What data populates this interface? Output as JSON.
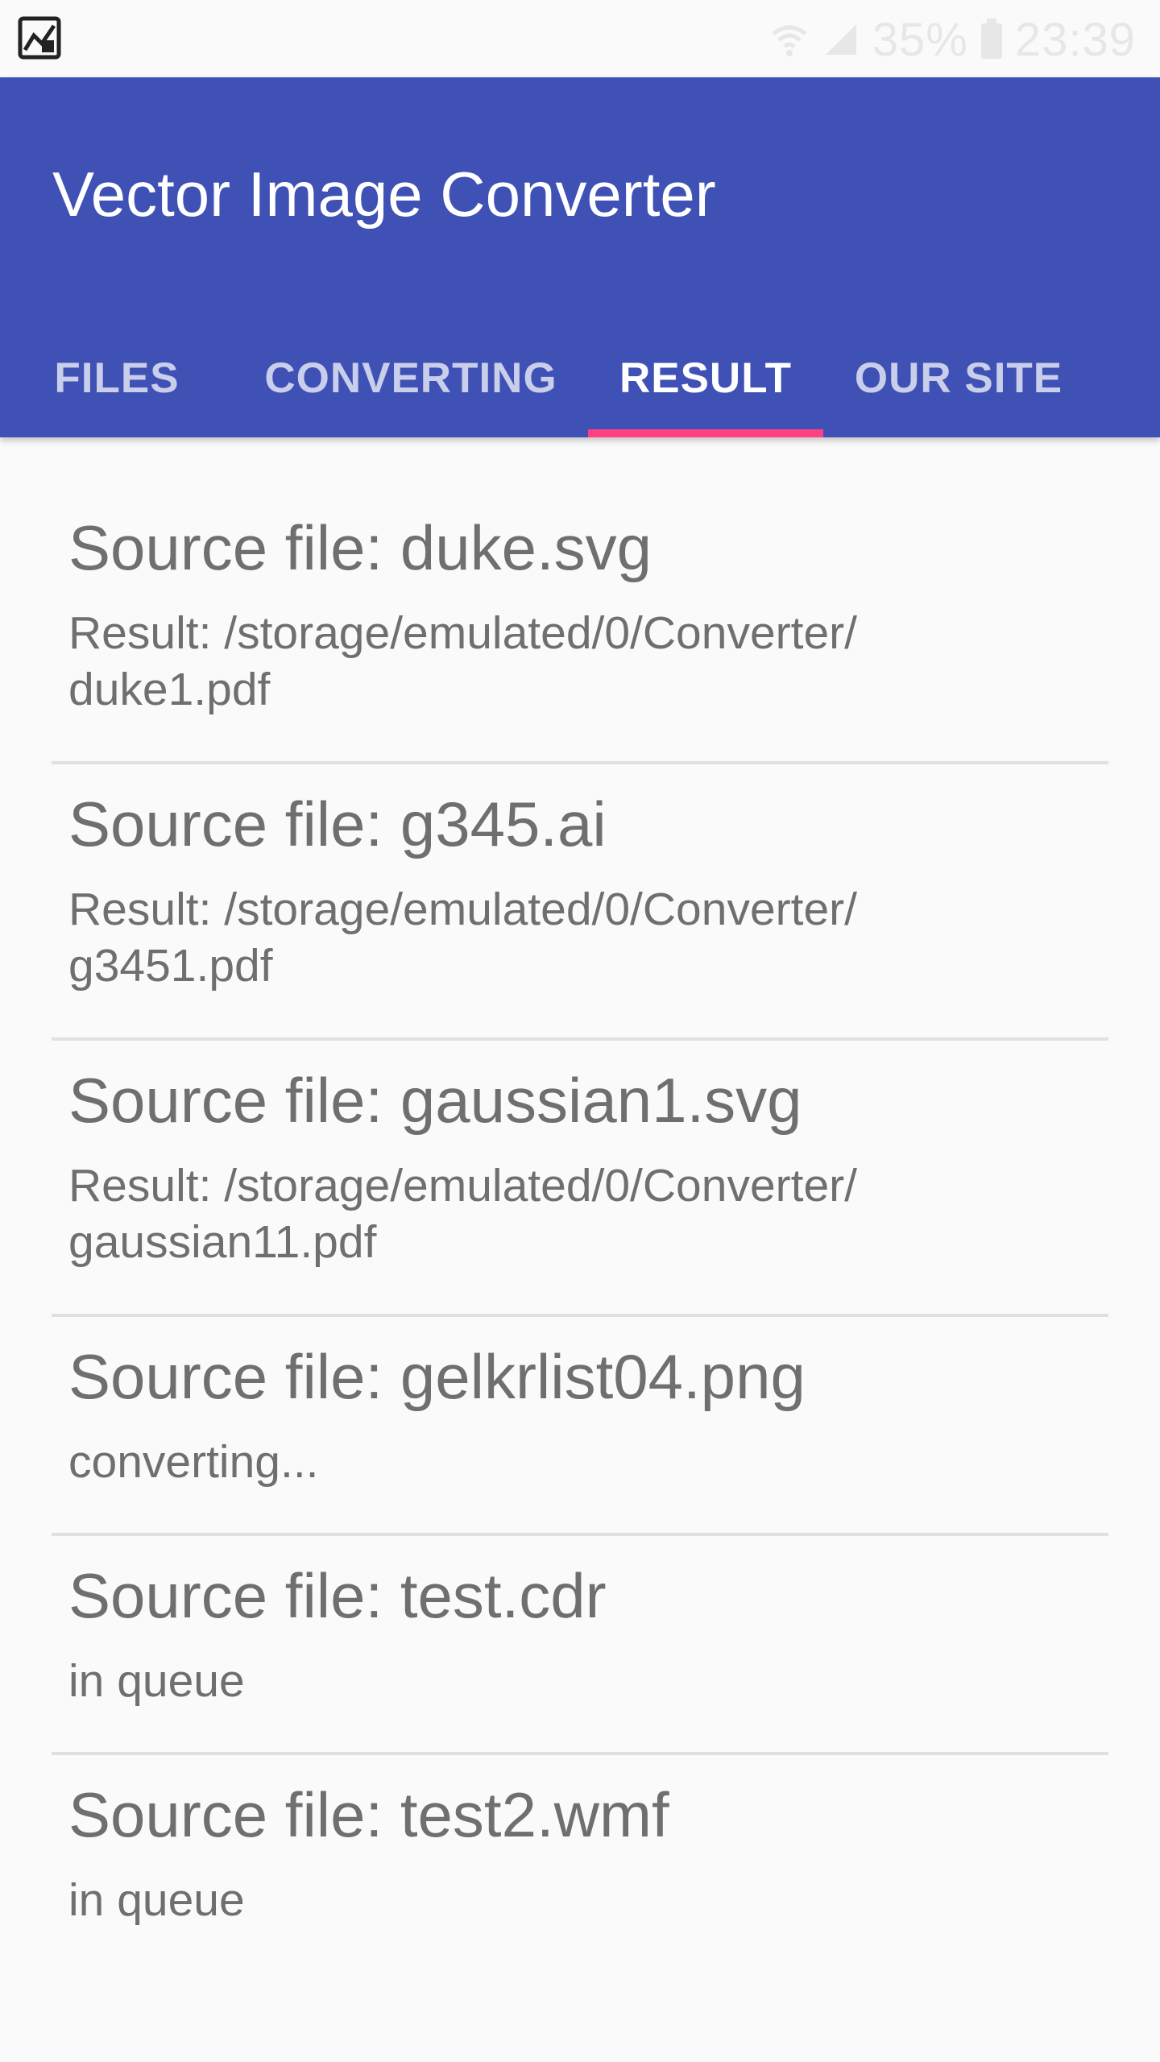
{
  "status_bar": {
    "app_icon": "app-notification-icon",
    "battery_percent": "35%",
    "time": "23:39",
    "wifi_icon": "wifi-icon",
    "signal_icon": "signal-icon",
    "battery_icon": "battery-icon"
  },
  "app_bar": {
    "title": "Vector Image Converter",
    "color": "#3f51b5",
    "indicator_color": "#ff4081"
  },
  "tabs": [
    {
      "label": "FILES",
      "active": false
    },
    {
      "label": "CONVERTING",
      "active": false
    },
    {
      "label": "RESULT",
      "active": true
    },
    {
      "label": "OUR SITE",
      "active": false
    }
  ],
  "results": [
    {
      "title": "Source file: duke.svg",
      "subtitle": "Result: /storage/emulated/0/Converter/\nduke1.pdf"
    },
    {
      "title": "Source file: g345.ai",
      "subtitle": "Result: /storage/emulated/0/Converter/\ng3451.pdf"
    },
    {
      "title": "Source file: gaussian1.svg",
      "subtitle": "Result: /storage/emulated/0/Converter/\ngaussian11.pdf"
    },
    {
      "title": "Source file: gelkrlist04.png",
      "subtitle": "converting..."
    },
    {
      "title": "Source file: test.cdr",
      "subtitle": "in queue"
    },
    {
      "title": "Source file: test2.wmf",
      "subtitle": "in queue"
    }
  ]
}
